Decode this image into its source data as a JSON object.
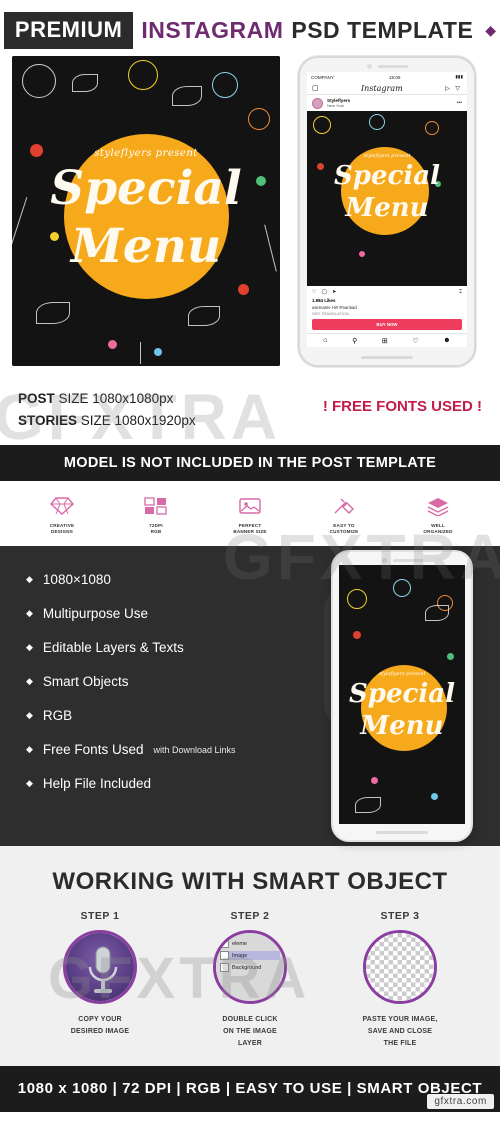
{
  "header": {
    "premium": "PREMIUM",
    "instagram": "INSTAGRAM",
    "psd_template": "PSD TEMPLATE",
    "diamond": "◆"
  },
  "poster": {
    "presents": "styleflyers present",
    "title_line1": "Special",
    "title_line2": "Menu"
  },
  "phone_preview": {
    "status_left": "COMPANY",
    "status_time": "15:09",
    "status_right": "▮▮▮",
    "app_name": "Instagram",
    "username": "Styleflyers",
    "location": "New York",
    "likes": "1.984 Likes",
    "caption": "username Hi!! #marinad",
    "translation": "SEE TRANSLATION",
    "cta": "BUY NOW",
    "more": "•••"
  },
  "sizes": {
    "post_label": "POST",
    "post_value": " SIZE 1080x1080px",
    "stories_label": "STORIES",
    "stories_value": " SIZE 1080x1920px",
    "free_fonts": "! FREE FONTS USED !"
  },
  "banner": {
    "text": "MODEL IS NOT INCLUDED IN THE POST TEMPLATE"
  },
  "features": [
    {
      "icon": "diamond-icon",
      "caption": "CREATIVE\nDESIGNS"
    },
    {
      "icon": "grid-icon",
      "caption": "72DPI\nRGB"
    },
    {
      "icon": "image-icon",
      "caption": "PERFECT\nBANNER SIZE"
    },
    {
      "icon": "tools-icon",
      "caption": "EASY TO\nCUSTOMIZE"
    },
    {
      "icon": "layers-icon",
      "caption": "WELL\nORGANIZED"
    }
  ],
  "bullets": [
    {
      "text": "1080×1080",
      "note": ""
    },
    {
      "text": "Multipurpose Use",
      "note": ""
    },
    {
      "text": "Editable Layers & Texts",
      "note": ""
    },
    {
      "text": "Smart Objects",
      "note": ""
    },
    {
      "text": "RGB",
      "note": ""
    },
    {
      "text": "Free Fonts Used",
      "note": "with Download Links"
    },
    {
      "text": "Help File Included",
      "note": ""
    }
  ],
  "smart_object": {
    "heading": "WORKING WITH SMART OBJECT",
    "steps": [
      {
        "title": "STEP 1",
        "caption": "COPY YOUR\nDESIRED IMAGE",
        "thumb": "microphone-photo"
      },
      {
        "title": "STEP 2",
        "caption": "DOUBLE CLICK\nON THE IMAGE\nLAYER",
        "thumb": "layers-panel"
      },
      {
        "title": "STEP 3",
        "caption": "PASTE YOUR IMAGE,\nSAVE AND CLOSE\nTHE FILE",
        "thumb": "transparent-checker"
      }
    ],
    "layers_panel": {
      "row1": "eleme",
      "row2": "Image",
      "row3": "Background"
    }
  },
  "bottom_bar": {
    "text": "1080 x 1080  |  72 DPI  |  RGB  |  EASY TO USE  |  SMART OBJECT",
    "credit": "gfxtra.com"
  },
  "watermark": {
    "left": "GFXTRA",
    "right": "GFXTRA",
    "center": "GFXTRA"
  },
  "colors": {
    "accent_purple": "#6f2b6f",
    "accent_pink": "#d96aa8",
    "accent_red": "#c31c4a",
    "dark": "#1c1c1c",
    "poster_bg": "#131313",
    "sun": "#f6a91b"
  }
}
